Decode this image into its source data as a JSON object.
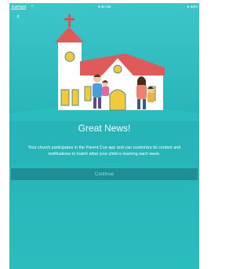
{
  "status_bar": {
    "carrier": "TestFlight",
    "time": "9:04 AM",
    "battery": "60%"
  },
  "icons": {
    "back": "chevron-left-icon",
    "wifi": "wifi-icon",
    "location": "location-arrow-icon"
  },
  "hero": {
    "title": "Great News!",
    "body": "Your church participates in the Parent Cue app and can customize its content and notifications to match what your child is learning each week."
  },
  "actions": {
    "continue_label": "Continue"
  },
  "colors": {
    "background_top": "#3dc6c9",
    "background_bottom": "#2bbcbe",
    "button_bg": "#1f8e95",
    "button_text": "#7ee3e4",
    "church_roof": "#e05a5a",
    "church_wall": "#ffffff"
  }
}
